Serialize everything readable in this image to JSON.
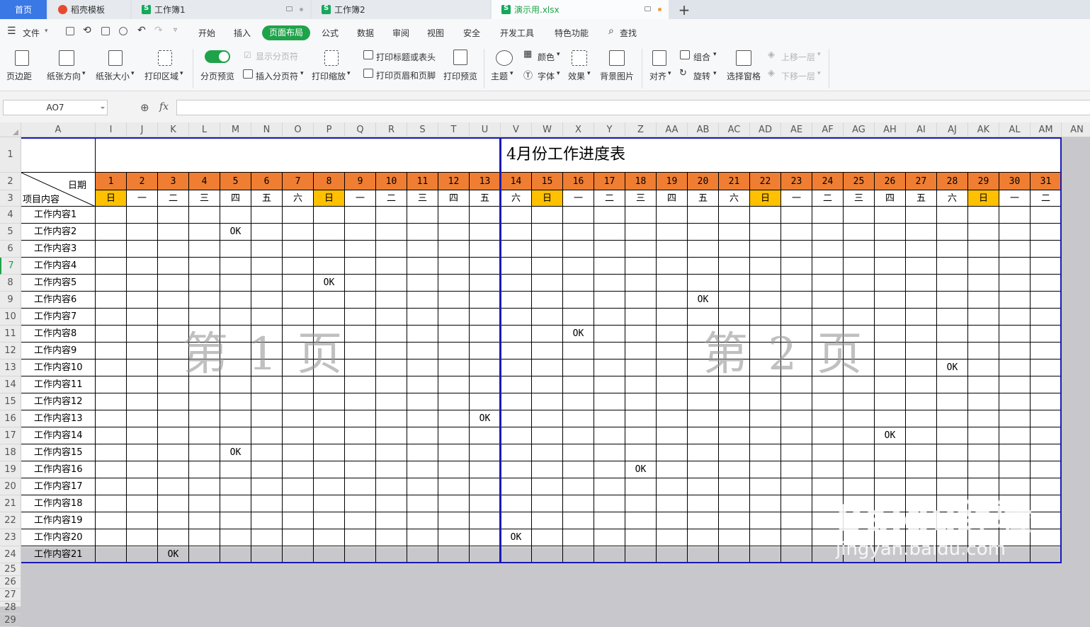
{
  "tabs": [
    {
      "label": "首页",
      "active": false
    },
    {
      "label": "稻壳模板",
      "active": false
    },
    {
      "label": "工作簿1",
      "active": false
    },
    {
      "label": "工作簿2",
      "active": false
    },
    {
      "label": "演示用.xlsx",
      "active": true
    }
  ],
  "new_tab": "+",
  "menu": {
    "file": "文件",
    "items": [
      "开始",
      "插入",
      "页面布局",
      "公式",
      "数据",
      "审阅",
      "视图",
      "安全",
      "开发工具",
      "特色功能"
    ],
    "active_item": "页面布局",
    "search": "查找"
  },
  "ribbon": {
    "margins": "页边距",
    "orientation": "纸张方向",
    "size": "纸张大小",
    "print_area": "打印区域",
    "page_break_preview": "分页预览",
    "show_page_break": "显示分页符",
    "insert_page_break": "插入分页符",
    "print_scale": "打印缩放",
    "print_titles": "打印标题或表头",
    "print_header_footer": "打印页眉和页脚",
    "print_preview": "打印预览",
    "theme": "主题",
    "colors": "颜色",
    "fonts": "字体",
    "effects": "效果",
    "background": "背景图片",
    "align": "对齐",
    "group": "组合",
    "rotate": "旋转",
    "selection_pane": "选择窗格",
    "bring_forward": "上移一层",
    "send_backward": "下移一层"
  },
  "formula_bar": {
    "name_box": "AO7",
    "fx": "fx",
    "value": ""
  },
  "columns": [
    "A",
    "I",
    "J",
    "K",
    "L",
    "M",
    "N",
    "O",
    "P",
    "Q",
    "R",
    "S",
    "T",
    "U",
    "V",
    "W",
    "X",
    "Y",
    "Z",
    "AA",
    "AB",
    "AC",
    "AD",
    "AE",
    "AF",
    "AG",
    "AH",
    "AI",
    "AJ",
    "AK",
    "AL",
    "AM",
    "AN"
  ],
  "rows": [
    "1",
    "2",
    "3",
    "4",
    "5",
    "6",
    "7",
    "8",
    "9",
    "10",
    "11",
    "12",
    "13",
    "14",
    "15",
    "16",
    "17",
    "18",
    "19",
    "20",
    "21",
    "22",
    "23",
    "24",
    "25",
    "26",
    "27",
    "28",
    "29"
  ],
  "sheet": {
    "title": "4月份工作进度表",
    "header_date": "日期",
    "header_item": "项目内容",
    "days": [
      "1",
      "2",
      "3",
      "4",
      "5",
      "6",
      "7",
      "8",
      "9",
      "10",
      "11",
      "12",
      "13",
      "14",
      "15",
      "16",
      "17",
      "18",
      "19",
      "20",
      "21",
      "22",
      "23",
      "24",
      "25",
      "26",
      "27",
      "28",
      "29",
      "30",
      "31"
    ],
    "weekdays": [
      "日",
      "一",
      "二",
      "三",
      "四",
      "五",
      "六",
      "日",
      "一",
      "二",
      "三",
      "四",
      "五",
      "六",
      "日",
      "一",
      "二",
      "三",
      "四",
      "五",
      "六",
      "日",
      "一",
      "二",
      "三",
      "四",
      "五",
      "六",
      "日",
      "一",
      "二"
    ],
    "items": [
      "工作内容1",
      "工作内容2",
      "工作内容3",
      "工作内容4",
      "工作内容5",
      "工作内容6",
      "工作内容7",
      "工作内容8",
      "工作内容9",
      "工作内容10",
      "工作内容11",
      "工作内容12",
      "工作内容13",
      "工作内容14",
      "工作内容15",
      "工作内容16",
      "工作内容17",
      "工作内容18",
      "工作内容19",
      "工作内容20",
      "工作内容21"
    ],
    "ok_text": "OK",
    "ok_marks": [
      {
        "item": 2,
        "day": 5
      },
      {
        "item": 5,
        "day": 8
      },
      {
        "item": 6,
        "day": 20
      },
      {
        "item": 8,
        "day": 16
      },
      {
        "item": 10,
        "day": 28
      },
      {
        "item": 13,
        "day": 13
      },
      {
        "item": 14,
        "day": 26
      },
      {
        "item": 15,
        "day": 5
      },
      {
        "item": 16,
        "day": 18
      },
      {
        "item": 20,
        "day": 14
      },
      {
        "item": 21,
        "day": 3
      }
    ],
    "page_labels": [
      "第 1 页",
      "第 2 页"
    ]
  },
  "colors": {
    "orange_header": "#ef7e32",
    "sunday": "#ffc000",
    "accent_green": "#1fa34a",
    "page_break": "#1a1ab4"
  },
  "watermark": {
    "logo": "Baidu经验",
    "url": "jingyan.baidu.com"
  }
}
